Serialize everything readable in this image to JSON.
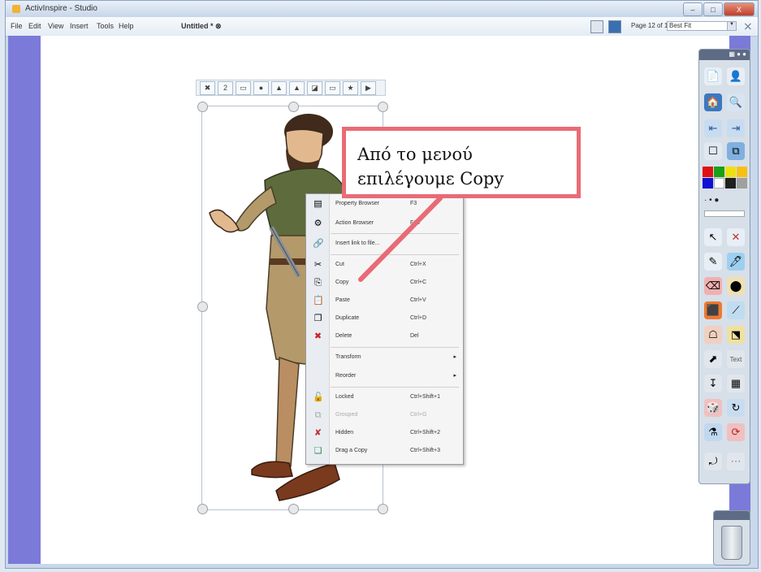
{
  "window": {
    "title": "ActivInspire - Studio",
    "buttons": [
      "–",
      "□",
      "X"
    ]
  },
  "menu": [
    "File",
    "Edit",
    "View",
    "Insert",
    "Tools",
    "Help"
  ],
  "document_tab": "Untitled * ⊗",
  "statusbar": {
    "page_indicator": "Page 12 of 12",
    "zoom": "Best Fit"
  },
  "object_toolbar": [
    "✖",
    "2",
    "▭",
    "●",
    "▲",
    "▲",
    "◪",
    "▭",
    "★",
    "▶"
  ],
  "context_menu": {
    "items": [
      {
        "label": "Property Browser",
        "shortcut": "F3",
        "icon": "properties-icon",
        "glyph": "▤"
      },
      {
        "label": "Action Browser",
        "shortcut": "F10",
        "icon": "action-icon",
        "glyph": "⚙"
      },
      {
        "label": "Insert link to file...",
        "shortcut": "",
        "icon": "link-icon",
        "glyph": "🔗"
      },
      {
        "label": "Cut",
        "shortcut": "Ctrl+X",
        "icon": "scissors-icon",
        "glyph": "✂"
      },
      {
        "label": "Copy",
        "shortcut": "Ctrl+C",
        "icon": "copy-icon",
        "glyph": "⎘"
      },
      {
        "label": "Paste",
        "shortcut": "Ctrl+V",
        "icon": "paste-icon",
        "glyph": "📋"
      },
      {
        "label": "Duplicate",
        "shortcut": "Ctrl+D",
        "icon": "duplicate-icon",
        "glyph": "❐"
      },
      {
        "label": "Delete",
        "shortcut": "Del",
        "icon": "delete-icon",
        "glyph": "✖"
      },
      {
        "label": "Transform",
        "shortcut": "",
        "icon": "",
        "glyph": "",
        "submenu": "▸"
      },
      {
        "label": "Reorder",
        "shortcut": "",
        "icon": "",
        "glyph": "",
        "submenu": "▸"
      },
      {
        "label": "Locked",
        "shortcut": "Ctrl+Shift+1",
        "icon": "lock-icon",
        "glyph": "🔓"
      },
      {
        "label": "Grouped",
        "shortcut": "Ctrl+G",
        "icon": "group-icon",
        "glyph": "⧉",
        "disabled": true
      },
      {
        "label": "Hidden",
        "shortcut": "Ctrl+Shift+2",
        "icon": "hidden-icon",
        "glyph": "✘"
      },
      {
        "label": "Drag a Copy",
        "shortcut": "Ctrl+Shift+3",
        "icon": "drag-copy-icon",
        "glyph": "❏"
      }
    ]
  },
  "callout": {
    "text": "Από το μενού\nεπιλέγουμε Copy"
  },
  "toolbox": {
    "palette": [
      "#e01010",
      "#18a018",
      "#f0e010",
      "#f8c010",
      "#1010d0",
      "#ffffff",
      "#202020",
      "#a0a0a0"
    ],
    "tools": [
      "📄",
      "👤",
      "🏠",
      "🔍",
      "⇤",
      "⇥",
      "☐",
      "⧉",
      "↖",
      "✕",
      "✎",
      "🖊",
      "⌫",
      "⬤",
      "⬛",
      "⟋",
      "☖",
      "⬔",
      "⬈",
      "T",
      "↧",
      "▦",
      "🎲",
      "↻",
      "⚗",
      "⟳",
      "⤾",
      "⋯"
    ],
    "text_tool": "Text"
  },
  "colors": {
    "flipchart_background": "#7b7ad8",
    "callout_border": "#e86b76",
    "annotation_arrow": "#e86b76"
  }
}
